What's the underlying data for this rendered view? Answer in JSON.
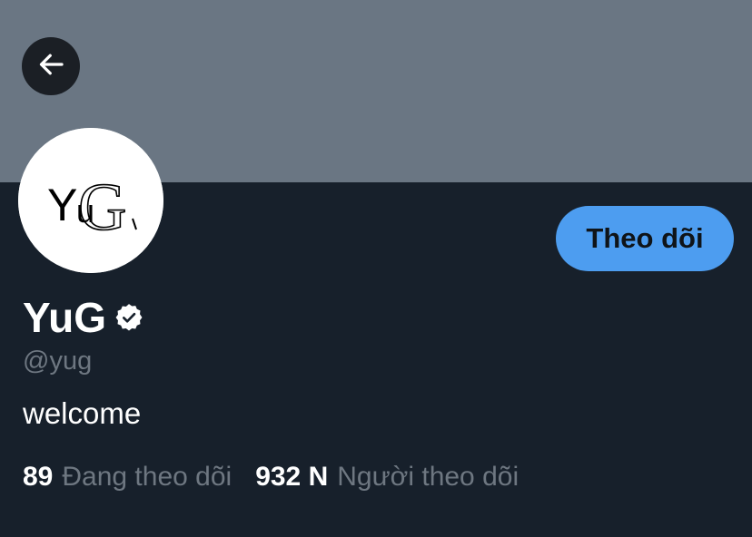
{
  "header": {
    "banner_color": "#6a7683",
    "back_icon": "arrow-left-icon"
  },
  "profile": {
    "avatar_text": "YuG",
    "display_name": "YuG",
    "verified": true,
    "verified_icon": "verified-badge-icon",
    "handle": "@yug",
    "bio": "welcome"
  },
  "actions": {
    "follow_label": "Theo dõi",
    "follow_color": "#4d9df0"
  },
  "stats": {
    "following_count": "89",
    "following_label": "Đang theo dõi",
    "followers_count": "932 N",
    "followers_label": "Người theo dõi"
  },
  "colors": {
    "background": "#17202b",
    "muted_text": "#6e7781"
  }
}
